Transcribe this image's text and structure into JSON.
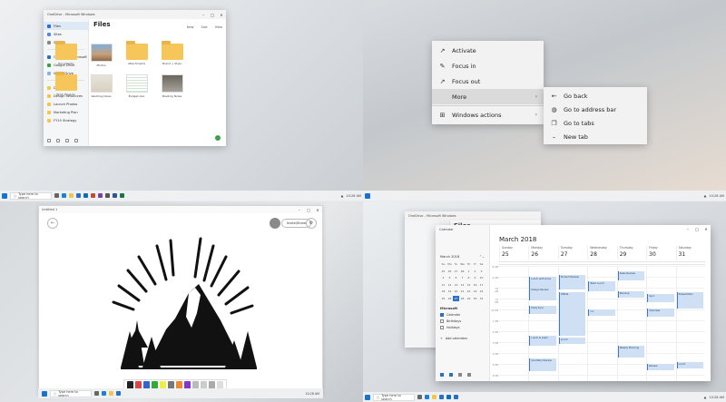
{
  "taskbar": {
    "search_placeholder": "Type here to search",
    "clock": "10:28 AM"
  },
  "files_window": {
    "title": "OneDrive - Microsoft Windows",
    "heading": "Files",
    "toolbar": [
      "New",
      "Sort",
      "View"
    ],
    "sidebar": [
      "Files",
      "Sites",
      "Shared",
      "OneDrive - Microsoft",
      "Google Drive",
      "iCloud Drive",
      "Documents",
      "Design Resources",
      "Launch Photos",
      "Marketing Plan",
      "FY19 Strategy"
    ],
    "items": [
      {
        "name": "Documents",
        "kind": "folder"
      },
      {
        "name": "Photos",
        "kind": "image"
      },
      {
        "name": "Attachments",
        "kind": "folder"
      },
      {
        "name": "Brand + Style",
        "kind": "folder"
      },
      {
        "name": "Work Projects",
        "kind": "folder"
      },
      {
        "name": "Wedding Ideas",
        "kind": "image"
      },
      {
        "name": "Budget.xlsx",
        "kind": "sheet"
      },
      {
        "name": "Meeting Notes",
        "kind": "doc"
      }
    ]
  },
  "context_menu": {
    "items": [
      {
        "label": "Activate",
        "icon": "arrow-up-right-icon"
      },
      {
        "label": "Focus in",
        "icon": "pencil-icon"
      },
      {
        "label": "Focus out",
        "icon": "arrow-up-right-icon"
      },
      {
        "label": "More",
        "icon": "",
        "submenu": true
      },
      {
        "label": "Windows actions",
        "icon": "windows-logo-icon",
        "submenu": true
      }
    ],
    "submenu": [
      {
        "label": "Go back",
        "icon": "arrow-left-icon"
      },
      {
        "label": "Go to address bar",
        "icon": "globe-icon"
      },
      {
        "label": "Go to tabs",
        "icon": "tabs-icon"
      },
      {
        "label": "New tab",
        "icon": "dash-icon"
      }
    ]
  },
  "whiteboard": {
    "title": "Untitled 1",
    "share_label": "Invite/Share",
    "taskbar_search": "Type here to search",
    "taskbar_clock": "10:28 AM"
  },
  "calendar": {
    "bg_title": "OneDrive - Microsoft Windows",
    "bg_heading": "Files",
    "title": "Calendar",
    "month": "March 2018",
    "mini_month": "March 2018",
    "mini_weekdays": [
      "Su",
      "Mo",
      "Tu",
      "We",
      "Th",
      "Fr",
      "Sa"
    ],
    "mini_days": [
      "25",
      "26",
      "27",
      "28",
      "1",
      "2",
      "3",
      "4",
      "5",
      "6",
      "7",
      "8",
      "9",
      "10",
      "11",
      "12",
      "13",
      "14",
      "15",
      "16",
      "17",
      "18",
      "19",
      "20",
      "21",
      "22",
      "23",
      "24",
      "25",
      "26",
      "27",
      "28",
      "29",
      "30",
      "31"
    ],
    "mini_today": "27",
    "account": "Microsoft",
    "calendars": [
      {
        "label": "Calendar",
        "checked": true
      },
      {
        "label": "Birthdays",
        "checked": false
      },
      {
        "label": "Holidays",
        "checked": false
      }
    ],
    "add_calendar": "Add calendars",
    "days": [
      {
        "name": "Sunday",
        "num": "25"
      },
      {
        "name": "Monday",
        "num": "26"
      },
      {
        "name": "Tuesday",
        "num": "27"
      },
      {
        "name": "Wednesday",
        "num": "28"
      },
      {
        "name": "Thursday",
        "num": "29"
      },
      {
        "name": "Friday",
        "num": "30"
      },
      {
        "name": "Saturday",
        "num": "31"
      }
    ],
    "times": [
      "8 AM",
      "9 AM",
      "10 AM",
      "11 AM",
      "12 PM",
      "1 PM",
      "2 PM",
      "3 PM",
      "4 PM",
      "5 PM",
      "6 PM"
    ],
    "events": [
      {
        "title": "Lunch with Anna",
        "day": 1,
        "start": 9.0,
        "dur": 1.0
      },
      {
        "title": "Design Review",
        "day": 1,
        "start": 10.0,
        "dur": 1.2
      },
      {
        "title": "Daily Sync",
        "day": 1,
        "start": 11.7,
        "dur": 0.7
      },
      {
        "title": "Product Review",
        "day": 2,
        "start": 8.8,
        "dur": 1.4
      },
      {
        "title": "Offsite",
        "day": 2,
        "start": 10.4,
        "dur": 4.0
      },
      {
        "title": "Lunch",
        "day": 2,
        "start": 14.6,
        "dur": 0.6
      },
      {
        "title": "Lunch & Learn",
        "day": 1,
        "start": 14.4,
        "dur": 0.9
      },
      {
        "title": "Quarterly Review",
        "day": 1,
        "start": 16.5,
        "dur": 1.2
      },
      {
        "title": "Team Lunch",
        "day": 3,
        "start": 9.4,
        "dur": 0.9
      },
      {
        "title": "1:1",
        "day": 3,
        "start": 12.0,
        "dur": 0.6
      },
      {
        "title": "Sales Review",
        "day": 4,
        "start": 8.5,
        "dur": 0.8
      },
      {
        "title": "Standup",
        "day": 4,
        "start": 10.3,
        "dur": 0.6
      },
      {
        "title": "Weekly Planning",
        "day": 4,
        "start": 15.3,
        "dur": 1.1
      },
      {
        "title": "Sync",
        "day": 5,
        "start": 10.6,
        "dur": 0.7
      },
      {
        "title": "Interview",
        "day": 5,
        "start": 11.9,
        "dur": 0.8
      },
      {
        "title": "Review",
        "day": 5,
        "start": 17.0,
        "dur": 0.6
      },
      {
        "title": "Presentation",
        "day": 6,
        "start": 10.4,
        "dur": 1.5
      },
      {
        "title": "Lunch",
        "day": 6,
        "start": 16.8,
        "dur": 0.6
      }
    ]
  },
  "colors": {
    "accent": "#2a6fc9",
    "folder": "#f6c65b",
    "event_bg": "#cfe0f4"
  }
}
